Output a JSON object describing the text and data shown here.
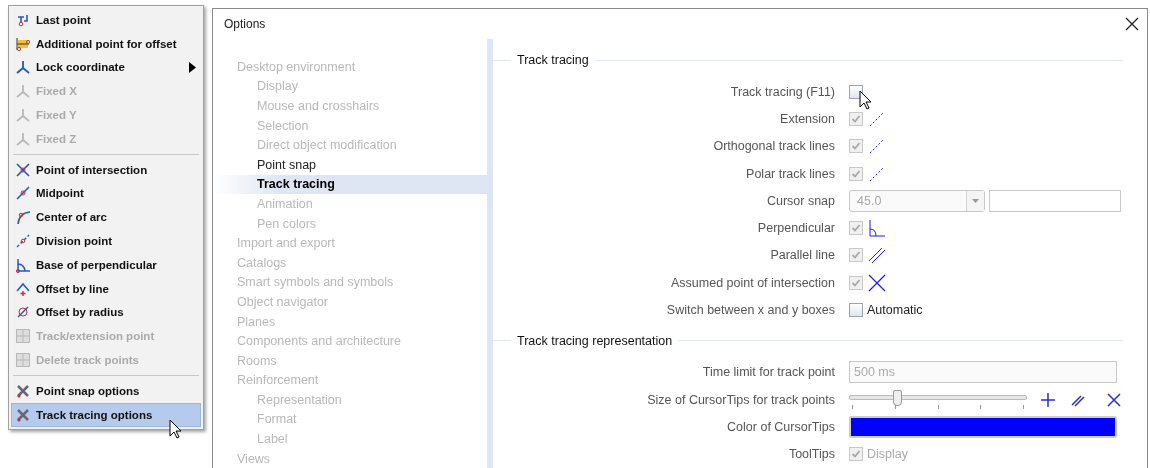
{
  "context_menu": {
    "groups": [
      {
        "items": [
          {
            "label": "Last point",
            "disabled": false,
            "selected": false,
            "submenu": false
          },
          {
            "label": "Additional point for offset",
            "disabled": false,
            "selected": false,
            "submenu": false
          },
          {
            "label": "Lock coordinate",
            "disabled": false,
            "selected": false,
            "submenu": true
          },
          {
            "label": "Fixed X",
            "disabled": true,
            "selected": false,
            "submenu": false
          },
          {
            "label": "Fixed Y",
            "disabled": true,
            "selected": false,
            "submenu": false
          },
          {
            "label": "Fixed Z",
            "disabled": true,
            "selected": false,
            "submenu": false
          }
        ]
      },
      {
        "items": [
          {
            "label": "Point of intersection",
            "disabled": false,
            "selected": false,
            "submenu": false
          },
          {
            "label": "Midpoint",
            "disabled": false,
            "selected": false,
            "submenu": false
          },
          {
            "label": "Center of arc",
            "disabled": false,
            "selected": false,
            "submenu": false
          },
          {
            "label": "Division point",
            "disabled": false,
            "selected": false,
            "submenu": false
          },
          {
            "label": "Base of perpendicular",
            "disabled": false,
            "selected": false,
            "submenu": false
          },
          {
            "label": "Offset by line",
            "disabled": false,
            "selected": false,
            "submenu": false
          },
          {
            "label": "Offset by radius",
            "disabled": false,
            "selected": false,
            "submenu": false
          },
          {
            "label": "Track/extension point",
            "disabled": true,
            "selected": false,
            "submenu": false
          },
          {
            "label": "Delete track points",
            "disabled": true,
            "selected": false,
            "submenu": false
          }
        ]
      },
      {
        "items": [
          {
            "label": "Point snap options",
            "disabled": false,
            "selected": false,
            "submenu": false
          },
          {
            "label": "Track tracing options",
            "disabled": false,
            "selected": true,
            "submenu": false
          }
        ]
      }
    ]
  },
  "window": {
    "title": "Options"
  },
  "tree": [
    {
      "label": "Desktop environment",
      "disabled": true,
      "selected": false,
      "children": [
        {
          "label": "Display",
          "disabled": true,
          "selected": false
        },
        {
          "label": "Mouse and crosshairs",
          "disabled": true,
          "selected": false
        },
        {
          "label": "Selection",
          "disabled": true,
          "selected": false
        },
        {
          "label": "Direct object modification",
          "disabled": true,
          "selected": false
        },
        {
          "label": "Point snap",
          "disabled": false,
          "selected": false
        },
        {
          "label": "Track tracing",
          "disabled": false,
          "selected": true
        },
        {
          "label": "Animation",
          "disabled": true,
          "selected": false
        },
        {
          "label": "Pen colors",
          "disabled": true,
          "selected": false
        }
      ]
    },
    {
      "label": "Import and export",
      "disabled": true,
      "selected": false
    },
    {
      "label": "Catalogs",
      "disabled": true,
      "selected": false
    },
    {
      "label": "Smart symbols and symbols",
      "disabled": true,
      "selected": false
    },
    {
      "label": "Object navigator",
      "disabled": true,
      "selected": false
    },
    {
      "label": "Planes",
      "disabled": true,
      "selected": false
    },
    {
      "label": "Components and architecture",
      "disabled": true,
      "selected": false
    },
    {
      "label": "Rooms",
      "disabled": true,
      "selected": false
    },
    {
      "label": "Reinforcement",
      "disabled": true,
      "selected": false,
      "children": [
        {
          "label": "Representation",
          "disabled": true,
          "selected": false
        },
        {
          "label": "Format",
          "disabled": true,
          "selected": false
        },
        {
          "label": "Label",
          "disabled": true,
          "selected": false
        }
      ]
    },
    {
      "label": "Views",
      "disabled": true,
      "selected": false
    }
  ],
  "sections": [
    {
      "title": "Track tracing",
      "rows": [
        {
          "label": "Track tracing (F11)",
          "kind": "checkbox",
          "checked": false,
          "disabled": false
        },
        {
          "label": "Extension",
          "kind": "checkbox",
          "checked": true,
          "disabled": true
        },
        {
          "label": "Orthogonal track lines",
          "kind": "checkbox",
          "checked": true,
          "disabled": true
        },
        {
          "label": "Polar track lines",
          "kind": "checkbox",
          "checked": true,
          "disabled": true
        },
        {
          "label": "Cursor snap",
          "kind": "combo",
          "value": "45.0",
          "disabled": true
        },
        {
          "label": "Perpendicular",
          "kind": "checkbox",
          "checked": true,
          "disabled": true
        },
        {
          "label": "Parallel line",
          "kind": "checkbox",
          "checked": true,
          "disabled": true
        },
        {
          "label": "Assumed point of intersection",
          "kind": "checkbox",
          "checked": true,
          "disabled": true
        },
        {
          "label": "Switch between x and y boxes",
          "kind": "checkbox",
          "checked": false,
          "disabled": false,
          "text": "Automatic"
        }
      ]
    },
    {
      "title": "Track tracing representation",
      "rows": [
        {
          "label": "Time limit for track point",
          "kind": "field",
          "value": "500 ms",
          "disabled": true
        },
        {
          "label": "Size of CursorTips for track points",
          "kind": "slider",
          "level": 0.26
        },
        {
          "label": "Color of CursorTips",
          "kind": "color",
          "color": "#0000ff"
        },
        {
          "label": "ToolTips",
          "kind": "checkbox",
          "checked": true,
          "disabled": true,
          "text": "Display"
        }
      ]
    }
  ]
}
